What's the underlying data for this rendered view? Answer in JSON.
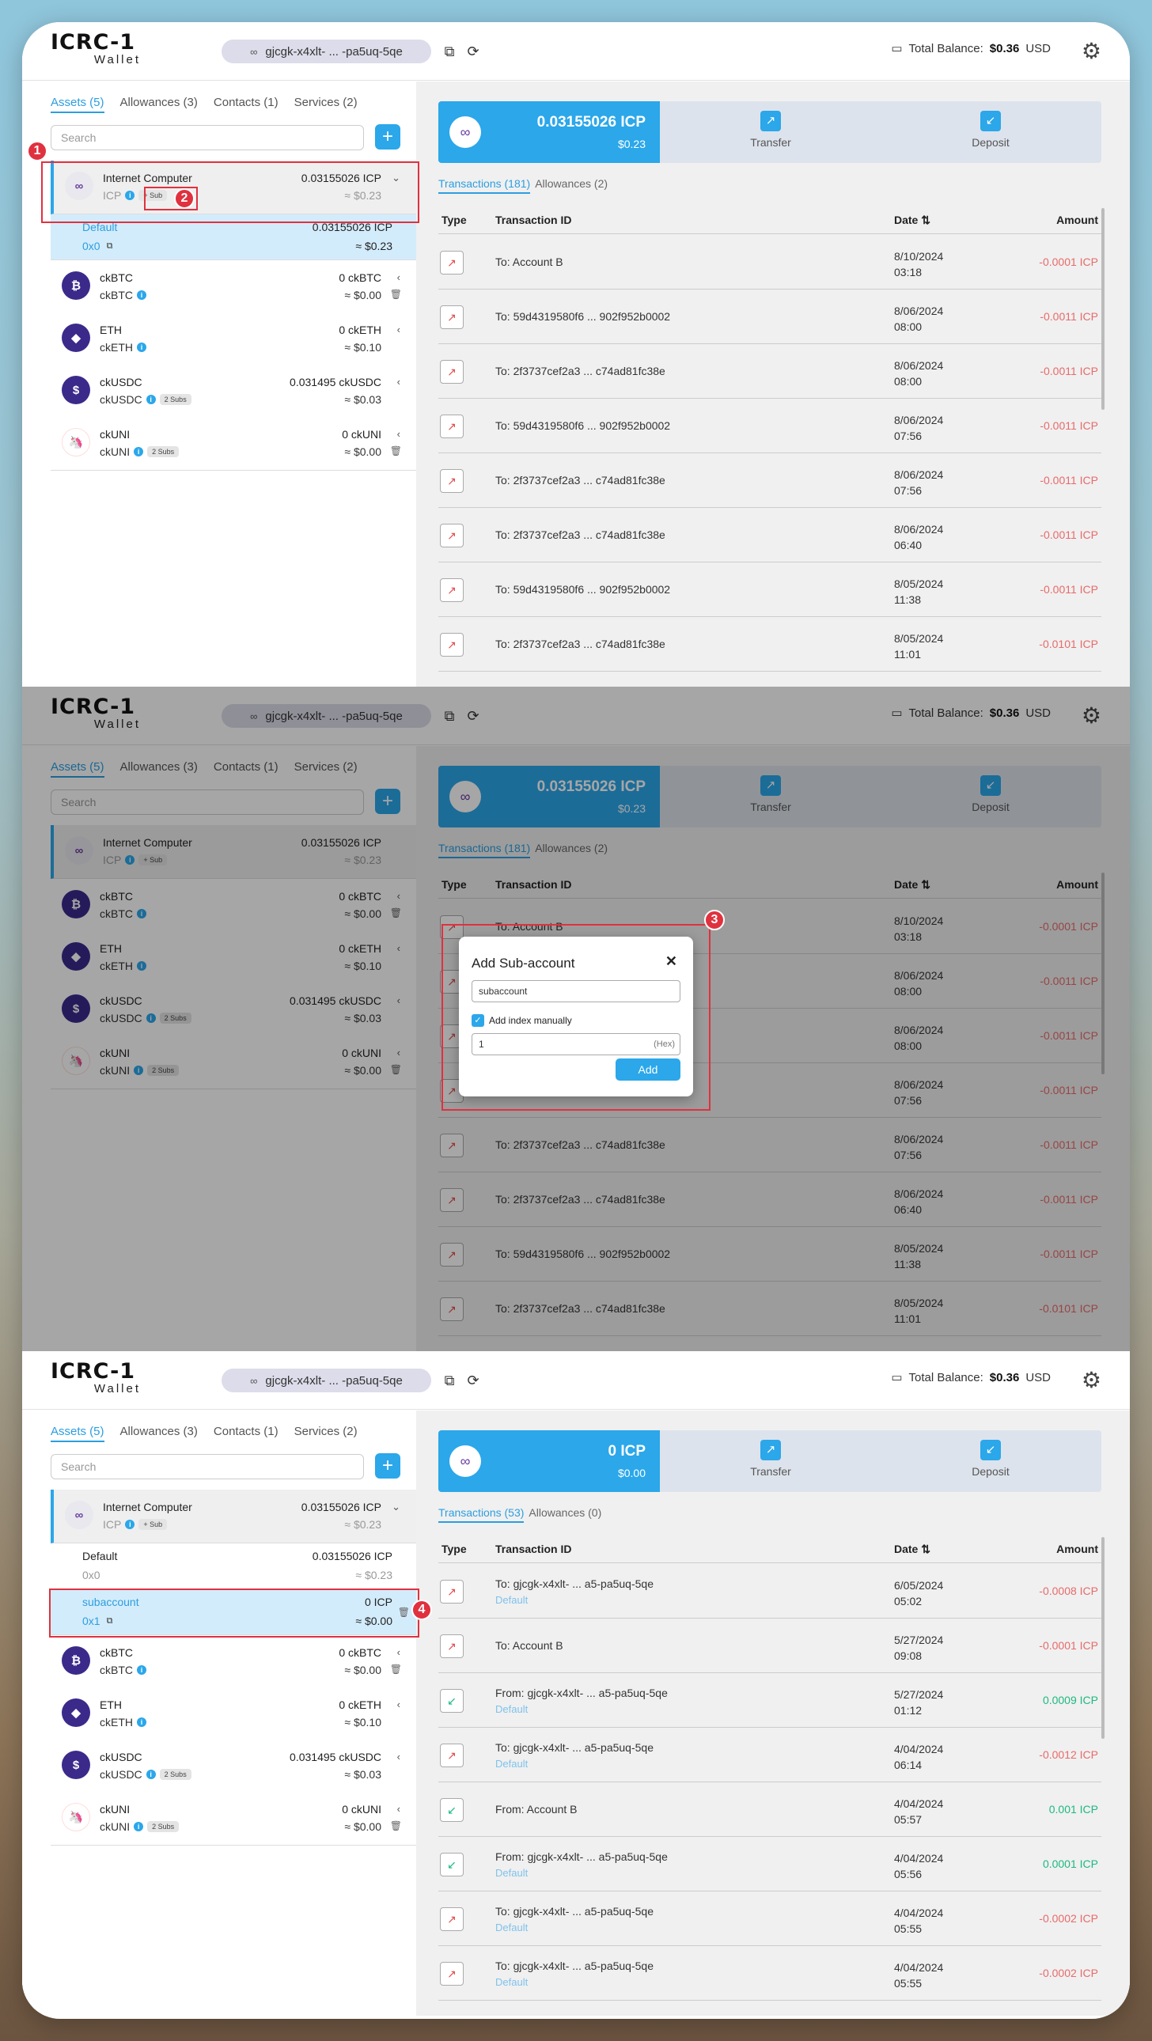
{
  "header": {
    "logo_top": "ICRC-1",
    "logo_bottom": "Wallet",
    "principal": "gjcgk-x4xlt- ... -pa5uq-5qe",
    "total_balance_label": "Total Balance:",
    "total_balance_value": "$0.36",
    "currency": "USD"
  },
  "left_tabs": [
    "Assets (5)",
    "Allowances (3)",
    "Contacts (1)",
    "Services (2)"
  ],
  "search_placeholder": "Search",
  "assets": [
    {
      "name": "Internet Computer",
      "symbol": "ICP",
      "amount": "0.03155026 ICP",
      "usd": "≈ $0.23",
      "badge": "+ Sub",
      "color": "#e8e8ee"
    },
    {
      "name": "ckBTC",
      "symbol": "ckBTC",
      "amount": "0 ckBTC",
      "usd": "≈ $0.00",
      "badge": "",
      "color": "#3b2a8a"
    },
    {
      "name": "ETH",
      "symbol": "ckETH",
      "amount": "0 ckETH",
      "usd": "≈ $0.10",
      "badge": "",
      "color": "#3b2a8a"
    },
    {
      "name": "ckUSDC",
      "symbol": "ckUSDC",
      "amount": "0.031495 ckUSDC",
      "usd": "≈ $0.03",
      "badge": "2 Subs",
      "color": "#3b2a8a"
    },
    {
      "name": "ckUNI",
      "symbol": "ckUNI",
      "amount": "0 ckUNI",
      "usd": "≈ $0.00",
      "badge": "2 Subs",
      "color": "#ff2d86"
    }
  ],
  "subaccounts": {
    "default": {
      "name": "Default",
      "index": "0x0",
      "amount": "0.03155026 ICP",
      "usd": "≈ $0.23"
    },
    "new": {
      "name": "subaccount",
      "index": "0x1",
      "amount": "0 ICP",
      "usd": "≈ $0.00"
    }
  },
  "balance_card": {
    "p1_amount": "0.03155026 ICP",
    "p1_usd": "$0.23",
    "p3_amount": "0 ICP",
    "p3_usd": "$0.00",
    "transfer": "Transfer",
    "deposit": "Deposit"
  },
  "tx_tabs": {
    "p1_tx": "Transactions (181)",
    "p1_allow": "Allowances (2)",
    "p3_tx": "Transactions (53)",
    "p3_allow": "Allowances (0)"
  },
  "tx_head": {
    "type": "Type",
    "id": "Transaction ID",
    "date": "Date ⇅",
    "amount": "Amount"
  },
  "tx_p1": [
    {
      "dir": "out",
      "id": "To: Account B",
      "date": "8/10/2024",
      "time": "03:18",
      "amount": "-0.0001 ICP"
    },
    {
      "dir": "out",
      "id": "To: 59d4319580f6 ... 902f952b0002",
      "date": "8/06/2024",
      "time": "08:00",
      "amount": "-0.0011 ICP"
    },
    {
      "dir": "out",
      "id": "To: 2f3737cef2a3 ... c74ad81fc38e",
      "date": "8/06/2024",
      "time": "08:00",
      "amount": "-0.0011 ICP"
    },
    {
      "dir": "out",
      "id": "To: 59d4319580f6 ... 902f952b0002",
      "date": "8/06/2024",
      "time": "07:56",
      "amount": "-0.0011 ICP"
    },
    {
      "dir": "out",
      "id": "To: 2f3737cef2a3 ... c74ad81fc38e",
      "date": "8/06/2024",
      "time": "07:56",
      "amount": "-0.0011 ICP"
    },
    {
      "dir": "out",
      "id": "To: 2f3737cef2a3 ... c74ad81fc38e",
      "date": "8/06/2024",
      "time": "06:40",
      "amount": "-0.0011 ICP"
    },
    {
      "dir": "out",
      "id": "To: 59d4319580f6 ... 902f952b0002",
      "date": "8/05/2024",
      "time": "11:38",
      "amount": "-0.0011 ICP"
    },
    {
      "dir": "out",
      "id": "To: 2f3737cef2a3 ... c74ad81fc38e",
      "date": "8/05/2024",
      "time": "11:01",
      "amount": "-0.0101 ICP"
    }
  ],
  "tx_p3": [
    {
      "dir": "out",
      "id": "To: gjcgk-x4xlt- ... a5-pa5uq-5qe",
      "sub": "Default",
      "date": "6/05/2024",
      "time": "05:02",
      "amount": "-0.0008 ICP"
    },
    {
      "dir": "out",
      "id": "To: Account B",
      "sub": "",
      "date": "5/27/2024",
      "time": "09:08",
      "amount": "-0.0001 ICP"
    },
    {
      "dir": "in",
      "id": "From: gjcgk-x4xlt- ... a5-pa5uq-5qe",
      "sub": "Default",
      "date": "5/27/2024",
      "time": "01:12",
      "amount": "0.0009 ICP"
    },
    {
      "dir": "out",
      "id": "To: gjcgk-x4xlt- ... a5-pa5uq-5qe",
      "sub": "Default",
      "date": "4/04/2024",
      "time": "06:14",
      "amount": "-0.0012 ICP"
    },
    {
      "dir": "in",
      "id": "From: Account B",
      "sub": "",
      "date": "4/04/2024",
      "time": "05:57",
      "amount": "0.001 ICP"
    },
    {
      "dir": "in",
      "id": "From: gjcgk-x4xlt- ... a5-pa5uq-5qe",
      "sub": "Default",
      "date": "4/04/2024",
      "time": "05:56",
      "amount": "0.0001 ICP"
    },
    {
      "dir": "out",
      "id": "To: gjcgk-x4xlt- ... a5-pa5uq-5qe",
      "sub": "Default",
      "date": "4/04/2024",
      "time": "05:55",
      "amount": "-0.0002 ICP"
    },
    {
      "dir": "out",
      "id": "To: gjcgk-x4xlt- ... a5-pa5uq-5qe",
      "sub": "Default",
      "date": "4/04/2024",
      "time": "05:55",
      "amount": "-0.0002 ICP"
    }
  ],
  "modal": {
    "title": "Add Sub-account",
    "name_value": "subaccount",
    "checkbox_label": "Add index manually",
    "index_value": "1",
    "hex_hint": "(Hex)",
    "add_label": "Add"
  },
  "markers": [
    "1",
    "2",
    "3",
    "4"
  ]
}
